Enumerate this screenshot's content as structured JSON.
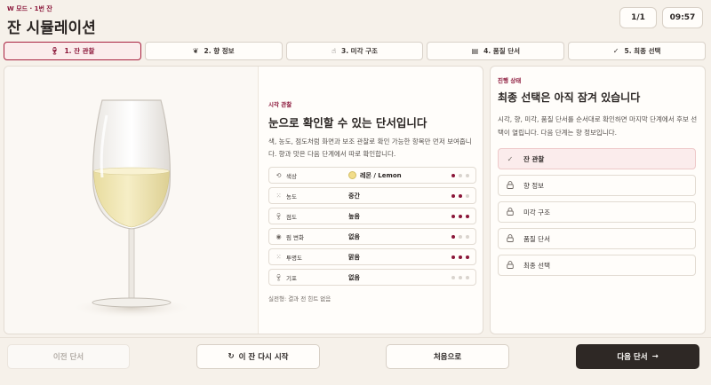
{
  "header": {
    "mode": "W 모드 · 1번 잔",
    "title": "잔 시뮬레이션",
    "page": "1/1",
    "timer": "09:57"
  },
  "tabs": [
    {
      "label": "1. 잔 관찰",
      "icon": "glass-icon",
      "active": true
    },
    {
      "label": "2. 향 정보",
      "icon": "aroma-icon",
      "active": false
    },
    {
      "label": "3. 미각 구조",
      "icon": "hand-icon",
      "active": false
    },
    {
      "label": "4. 품질 단서",
      "icon": "document-icon",
      "active": false
    },
    {
      "label": "5. 최종 선택",
      "icon": "check-icon",
      "active": false
    }
  ],
  "observation": {
    "section_label": "시각 관찰",
    "title": "눈으로 확인할 수 있는 단서입니다",
    "description": "색, 농도, 점도처럼 화면과 보조 관찰로 확인 가능한 항목만 먼저 보여줍니다. 향과 맛은 다음 단계에서 따로 확인합니다.",
    "rows": [
      {
        "label": "색상",
        "value": "레몬 / Lemon",
        "icon": "droplet-icon",
        "level": 1,
        "swatch": "#f2dd8a"
      },
      {
        "label": "농도",
        "value": "중간",
        "icon": "intensity-icon",
        "level": 2
      },
      {
        "label": "점도",
        "value": "높음",
        "icon": "viscosity-icon",
        "level": 3
      },
      {
        "label": "림 변화",
        "value": "없음",
        "icon": "eye-icon",
        "level": 1
      },
      {
        "label": "투명도",
        "value": "맑음",
        "icon": "clarity-icon",
        "level": 3
      },
      {
        "label": "기포",
        "value": "없음",
        "icon": "bubble-icon",
        "level": 0
      }
    ],
    "note": "실전형: 결과 전 힌트 없음"
  },
  "progress": {
    "label": "진행 상태",
    "title": "최종 선택은 아직 잠겨 있습니다",
    "description": "시각, 향, 미각, 품질 단서를 순서대로 확인하면 마지막 단계에서 후보 선택이 열립니다. 다음 단계는 향 정보입니다.",
    "steps": [
      {
        "label": "잔 관찰",
        "done": true
      },
      {
        "label": "향 정보",
        "done": false
      },
      {
        "label": "미각 구조",
        "done": false
      },
      {
        "label": "품질 단서",
        "done": false
      },
      {
        "label": "최종 선택",
        "done": false
      }
    ]
  },
  "footer": {
    "prev": "이전 단서",
    "restart": "이 잔 다시 시작",
    "home": "처음으로",
    "next": "다음 단서"
  },
  "colors": {
    "accent": "#8a1538",
    "wine": "#f2e7b8",
    "background": "#f6f1ea"
  }
}
